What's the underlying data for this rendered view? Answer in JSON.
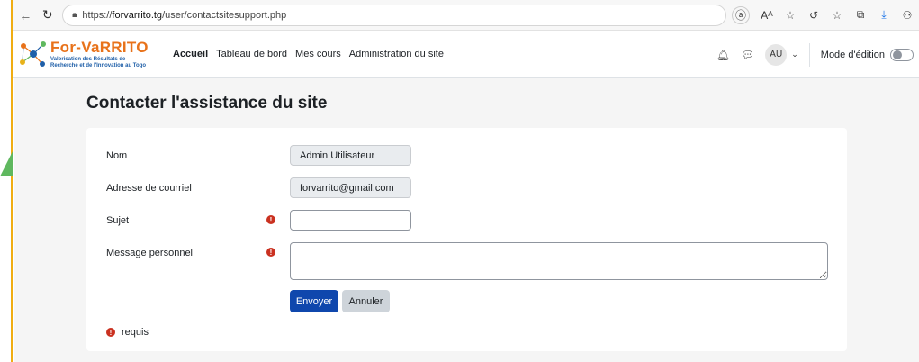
{
  "browser": {
    "url_prefix": "https://",
    "url_host": "forvarrito.tg",
    "url_path": "/user/contactsitesupport.php",
    "icons": [
      "back-icon",
      "reload-icon",
      "lock-icon",
      "read-aloud-icon",
      "text-size-icon",
      "favorites-add-icon",
      "refresh-icon",
      "favorites-icon",
      "collections-icon",
      "downloads-icon",
      "profile-icon"
    ]
  },
  "logo": {
    "title": "For-VaRRITO",
    "subtitle_line1": "Valorisation des Résultats de",
    "subtitle_line2": "Recherche et de l'Innovation au Togo"
  },
  "nav": {
    "items": [
      {
        "label": "Accueil",
        "active": true
      },
      {
        "label": "Tableau de bord",
        "active": false
      },
      {
        "label": "Mes cours",
        "active": false
      },
      {
        "label": "Administration du site",
        "active": false
      }
    ],
    "avatar_initials": "AU",
    "edit_mode_label": "Mode d'édition",
    "edit_mode_on": false
  },
  "page": {
    "title": "Contacter l'assistance du site"
  },
  "form": {
    "name_label": "Nom",
    "name_value": "Admin Utilisateur",
    "email_label": "Adresse de courriel",
    "email_value": "forvarrito@gmail.com",
    "subject_label": "Sujet",
    "subject_value": "",
    "message_label": "Message personnel",
    "message_value": "",
    "required_icon": "!",
    "submit_label": "Envoyer",
    "cancel_label": "Annuler",
    "required_legend": "requis"
  },
  "colors": {
    "primary": "#0f47ad",
    "required": "#ca3120",
    "logo_orange": "#e8721a",
    "logo_blue": "#1f5fa8",
    "frame_accent": "#f0ad12",
    "arrow_green": "#5fb85f"
  }
}
